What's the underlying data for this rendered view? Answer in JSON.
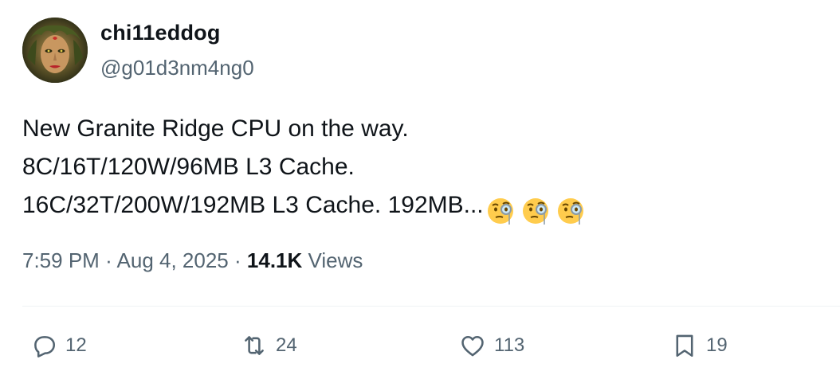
{
  "author": {
    "display_name": "chi11eddog",
    "handle": "@g01d3nm4ng0"
  },
  "tweet": {
    "lines": [
      "New Granite Ridge CPU on the way.",
      "8C/16T/120W/96MB L3 Cache.",
      "16C/32T/200W/192MB L3 Cache. 192MB..."
    ],
    "emojis": [
      "face-with-monocle-icon",
      "face-with-monocle-icon",
      "face-with-monocle-icon"
    ]
  },
  "meta": {
    "time": "7:59 PM",
    "separator": "·",
    "date": "Aug 4, 2025",
    "views_count": "14.1K",
    "views_label": "Views"
  },
  "actions": {
    "reply_count": "12",
    "retweet_count": "24",
    "like_count": "113",
    "bookmark_count": "19"
  },
  "colors": {
    "text_primary": "#0f1419",
    "text_secondary": "#536471",
    "divider": "#eff3f4",
    "emoji_face": "#ffcc4d"
  }
}
